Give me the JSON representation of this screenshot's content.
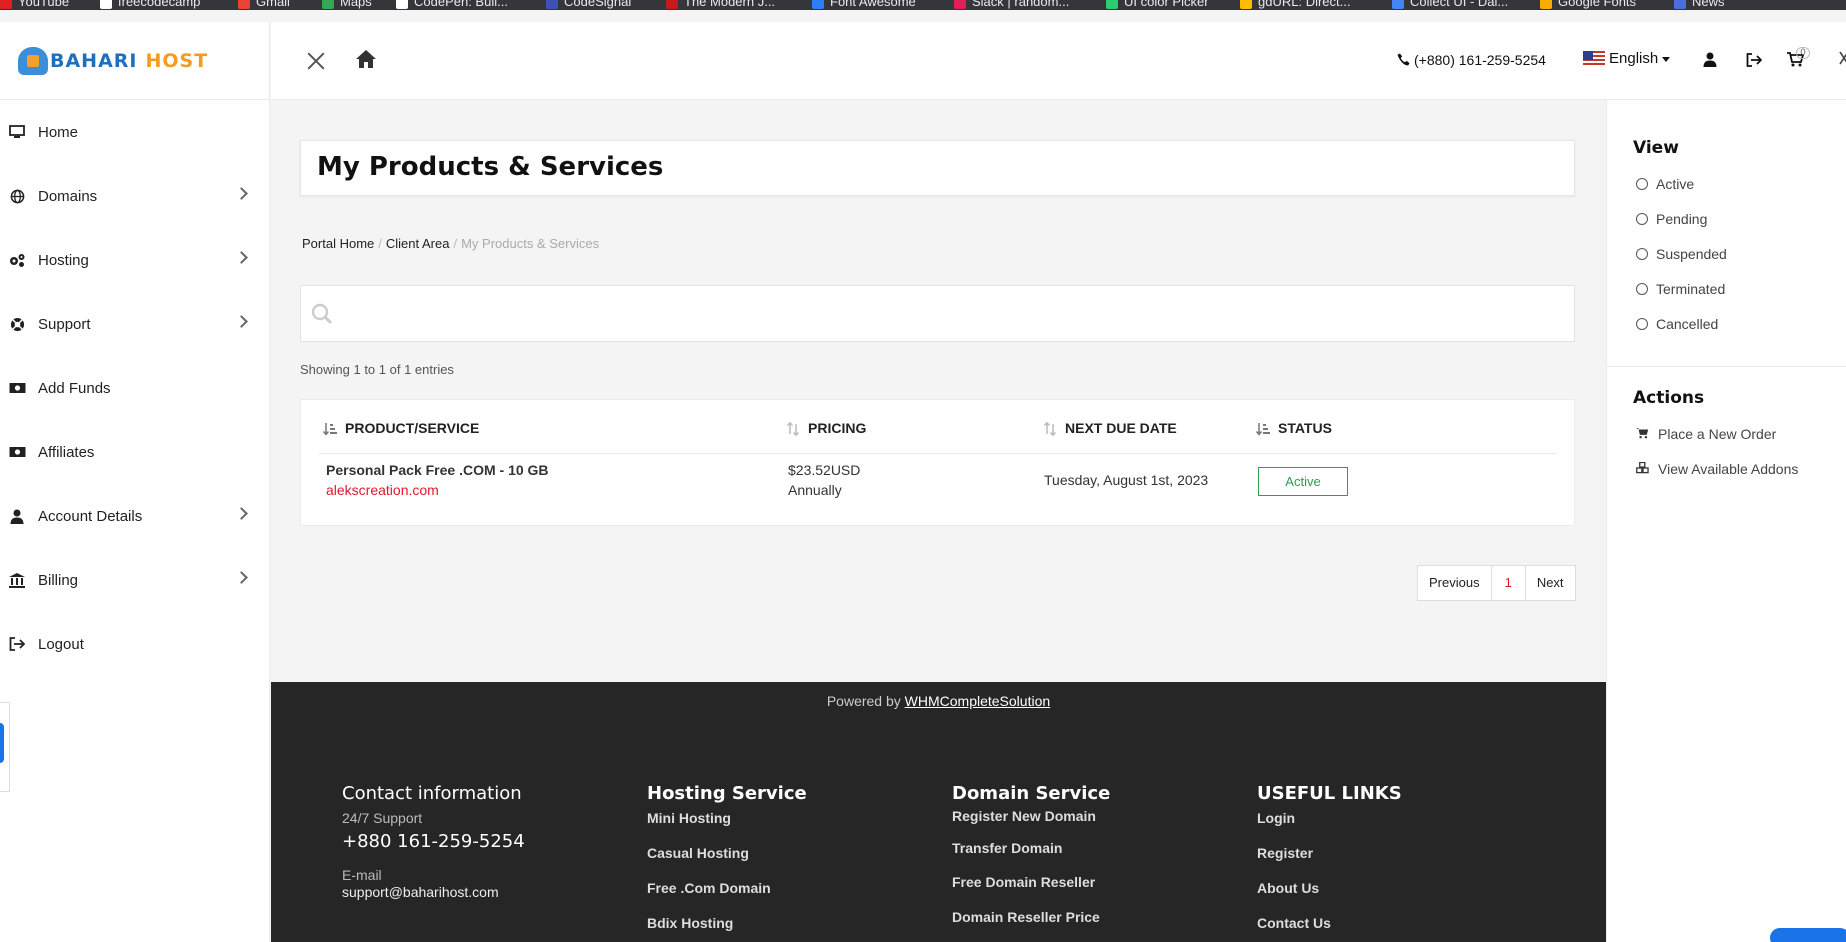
{
  "bookmarks": [
    "YouTube",
    "freecodecamp",
    "Gmail",
    "Maps",
    "CodePen: Buil...",
    "CodeSignal",
    "The Modern J...",
    "Font Awesome",
    "Slack | random...",
    "UI color Picker",
    "gdURL: Direct...",
    "Collect UI - Dai...",
    "Google Fonts",
    "News"
  ],
  "brand": {
    "part1": "BAHARI",
    "part2": "HOST"
  },
  "sidebar": {
    "items": [
      {
        "label": "Home",
        "icon": "desktop-icon",
        "has_children": false
      },
      {
        "label": "Domains",
        "icon": "globe-icon",
        "has_children": true
      },
      {
        "label": "Hosting",
        "icon": "gears-icon",
        "has_children": true
      },
      {
        "label": "Support",
        "icon": "life-ring-icon",
        "has_children": true
      },
      {
        "label": "Add Funds",
        "icon": "money-icon",
        "has_children": false
      },
      {
        "label": "Affiliates",
        "icon": "money-icon",
        "has_children": false
      },
      {
        "label": "Account Details",
        "icon": "user-icon",
        "has_children": true
      },
      {
        "label": "Billing",
        "icon": "bank-icon",
        "has_children": true
      },
      {
        "label": "Logout",
        "icon": "sign-out-icon",
        "has_children": false
      }
    ]
  },
  "header": {
    "phone": "(+880) 161-259-5254",
    "language": "English",
    "cart_count": "0"
  },
  "main": {
    "title": "My Products & Services",
    "breadcrumb": {
      "home": "Portal Home",
      "client": "Client Area",
      "current": "My Products & Services"
    },
    "search_placeholder": "",
    "entries_text": "Showing 1 to 1 of 1 entries",
    "table": {
      "headers": [
        "PRODUCT/SERVICE",
        "PRICING",
        "NEXT DUE DATE",
        "STATUS"
      ],
      "rows": [
        {
          "product": "Personal Pack Free .COM - 10 GB",
          "domain": "alekscreation.com",
          "price": "$23.52USD",
          "cycle": "Annually",
          "due": "Tuesday, August 1st, 2023",
          "status": "Active"
        }
      ]
    },
    "pager": {
      "prev": "Previous",
      "page": "1",
      "next": "Next"
    }
  },
  "rpanel": {
    "view_title": "View",
    "filters": [
      "Active",
      "Pending",
      "Suspended",
      "Terminated",
      "Cancelled"
    ],
    "actions_title": "Actions",
    "actions": [
      {
        "label": "Place a New Order",
        "icon": "cart-icon"
      },
      {
        "label": "View Available Addons",
        "icon": "cubes-icon"
      }
    ]
  },
  "footer": {
    "powered_prefix": "Powered by",
    "powered_link": "WHMCompleteSolution",
    "contact": {
      "title": "Contact information",
      "support_label": "24/7 Support",
      "phone": "+880 161-259-5254",
      "email_label": "E-mail",
      "email": "support@baharihost.com"
    },
    "hosting": {
      "title": "Hosting Service",
      "links": [
        "Mini Hosting",
        "Casual Hosting",
        "Free .Com Domain",
        "Bdix Hosting"
      ]
    },
    "domain": {
      "title": "Domain Service",
      "links": [
        "Register New Domain",
        "Transfer Domain",
        "Free Domain Reseller",
        "Domain Reseller Price"
      ]
    },
    "useful": {
      "title": "USEFUL LINKS",
      "links": [
        "Login",
        "Register",
        "About Us",
        "Contact Us"
      ]
    }
  },
  "colors": {
    "accent_red": "#e0192a",
    "status_green": "#2e9e4f",
    "footer_bg": "#262626",
    "brand_blue": "#1e6fc0",
    "brand_orange": "#f39b22"
  }
}
